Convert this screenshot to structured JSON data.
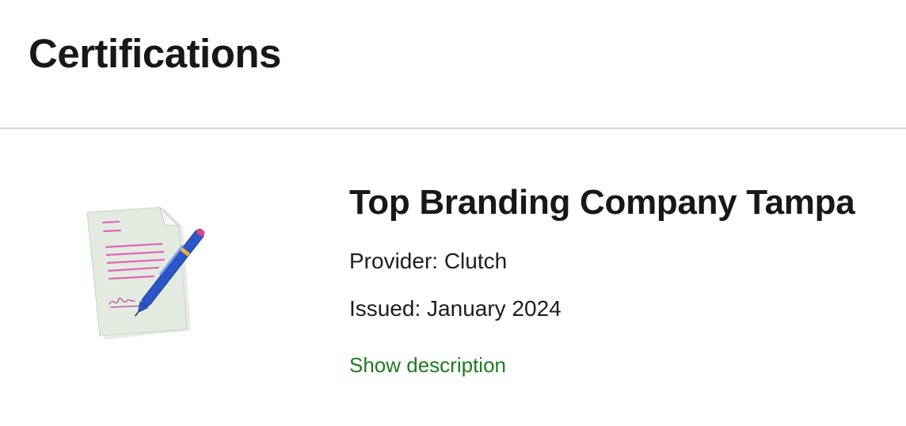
{
  "section": {
    "title": "Certifications"
  },
  "certifications": [
    {
      "name": "Top Branding Company Tampa",
      "provider_label": "Provider: Clutch",
      "issued_label": "Issued: January 2024",
      "show_description_label": "Show description",
      "icon": "document-signing-pen-icon"
    }
  ],
  "colors": {
    "link": "#1f7a1f",
    "divider": "#d5d5d5",
    "text": "#181818"
  }
}
